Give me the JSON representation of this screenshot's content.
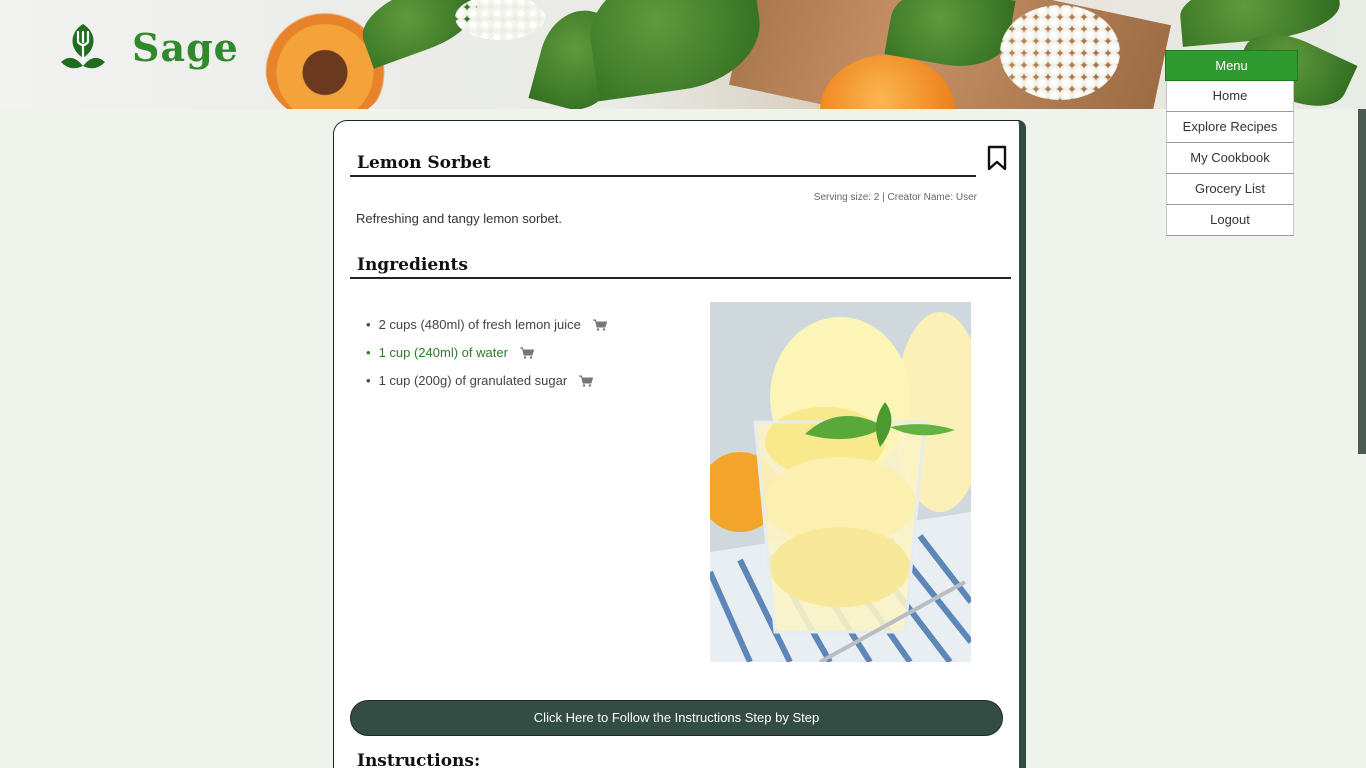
{
  "app": {
    "name": "Sage"
  },
  "menu": {
    "button_label": "Menu",
    "items": [
      {
        "label": "Home"
      },
      {
        "label": "Explore Recipes"
      },
      {
        "label": "My Cookbook"
      },
      {
        "label": "Grocery List"
      },
      {
        "label": "Logout"
      }
    ]
  },
  "recipe": {
    "title": "Lemon Sorbet",
    "meta": "Serving size: 2 | Creator Name: User",
    "description": "Refreshing and tangy lemon sorbet.",
    "ingredients_heading": "Ingredients",
    "ingredients": [
      {
        "text": "2 cups (480ml) of fresh lemon juice",
        "highlighted": false
      },
      {
        "text": "1 cup (240ml) of water",
        "highlighted": true
      },
      {
        "text": "1 cup (200g) of granulated sugar",
        "highlighted": false
      }
    ],
    "follow_button": "Click Here to Follow the Instructions Step by Step",
    "instructions_heading": "Instructions:"
  },
  "colors": {
    "accent_green": "#2f9a2f",
    "dark_teal": "#344d44",
    "page_bg": "#eef4ec"
  },
  "icons": [
    "logo-leaf-fork-icon",
    "bookmark-icon",
    "cart-icon"
  ]
}
